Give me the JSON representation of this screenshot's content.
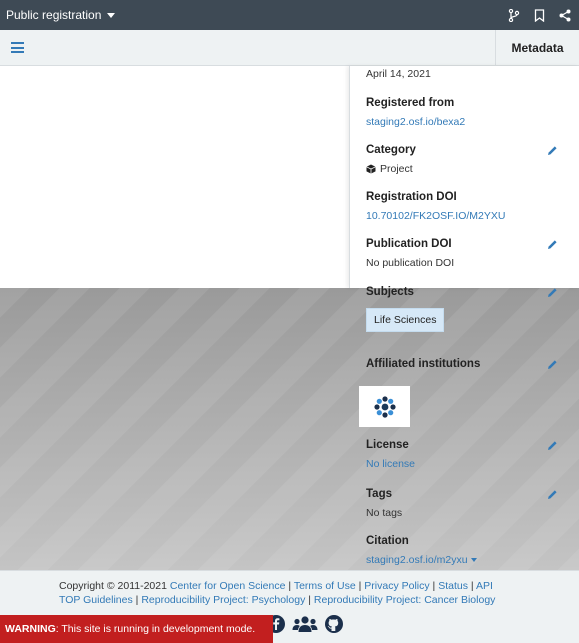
{
  "topbar": {
    "title": "Public registration",
    "icons": [
      "branch-icon",
      "bookmark-icon",
      "share-icon"
    ]
  },
  "subbar": {
    "menu_icon": "hamburger-icon",
    "metadata_tab": "Metadata"
  },
  "metadata": {
    "date_value": "April 14, 2021",
    "registered_from": {
      "label": "Registered from",
      "value": "staging2.osf.io/bexa2"
    },
    "category": {
      "label": "Category",
      "value": "Project"
    },
    "registration_doi": {
      "label": "Registration DOI",
      "value": "10.70102/FK2OSF.IO/M2YXU"
    },
    "publication_doi": {
      "label": "Publication DOI",
      "value": "No publication DOI"
    },
    "subjects": {
      "label": "Subjects",
      "chip": "Life Sciences"
    },
    "affiliated": {
      "label": "Affiliated institutions"
    },
    "license": {
      "label": "License",
      "value": "No license"
    },
    "tags": {
      "label": "Tags",
      "value": "No tags"
    },
    "citation": {
      "label": "Citation",
      "value": "staging2.osf.io/m2yxu"
    }
  },
  "footer": {
    "copyright": "Copyright © 2011-2021",
    "cos": "Center for Open Science",
    "terms": "Terms of Use",
    "privacy": "Privacy Policy",
    "status": "Status",
    "api": "API",
    "top": "TOP Guidelines",
    "rp_psych": "Reproducibility Project: Psychology",
    "rp_cancer": "Reproducibility Project: Cancer Biology",
    "sep": "|"
  },
  "warning": {
    "label": "WARNING",
    "text": ": This site is running in development mode."
  },
  "colors": {
    "topbar": "#3e4a55",
    "link": "#337ab7",
    "chip": "#d6e8f7",
    "warning": "#c21f1f"
  }
}
